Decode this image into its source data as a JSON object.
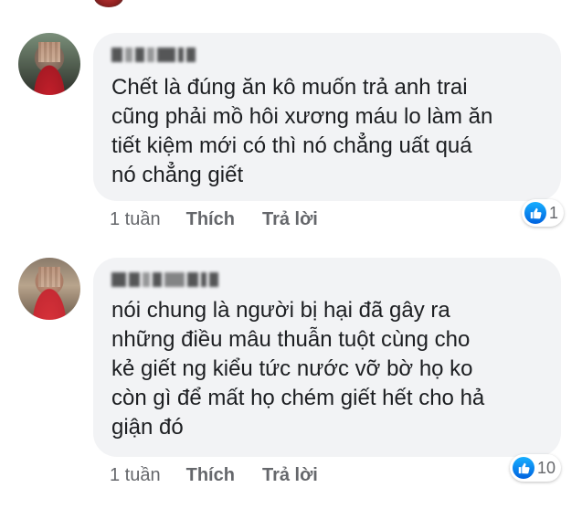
{
  "comments": [
    {
      "text": "Chết là đúng ăn kô muốn trả anh trai\ncũng phải mồ hôi xương máu lo làm ăn\ntiết kiệm mới có thì nó chẳng uất quá\nnó chẳng giết",
      "time": "1 tuần",
      "like_label": "Thích",
      "reply_label": "Trả lời",
      "reaction_count": "1",
      "reaction_icon": "like-icon"
    },
    {
      "text": "nói chung là người bị hại đã gây ra\nnhững điều mâu thuẫn tuột cùng cho\nkẻ giết ng kiểu tức nước vỡ bờ họ ko\ncòn gì để mất họ chém giết hết cho hả\ngiận đó",
      "time": "1 tuần",
      "like_label": "Thích",
      "reply_label": "Trả lời",
      "reaction_count": "10",
      "reaction_icon": "like-icon"
    }
  ],
  "colors": {
    "bubble": "#f2f3f5",
    "text": "#1c1e21",
    "meta": "#65676b",
    "like_blue": "#1877f2"
  }
}
